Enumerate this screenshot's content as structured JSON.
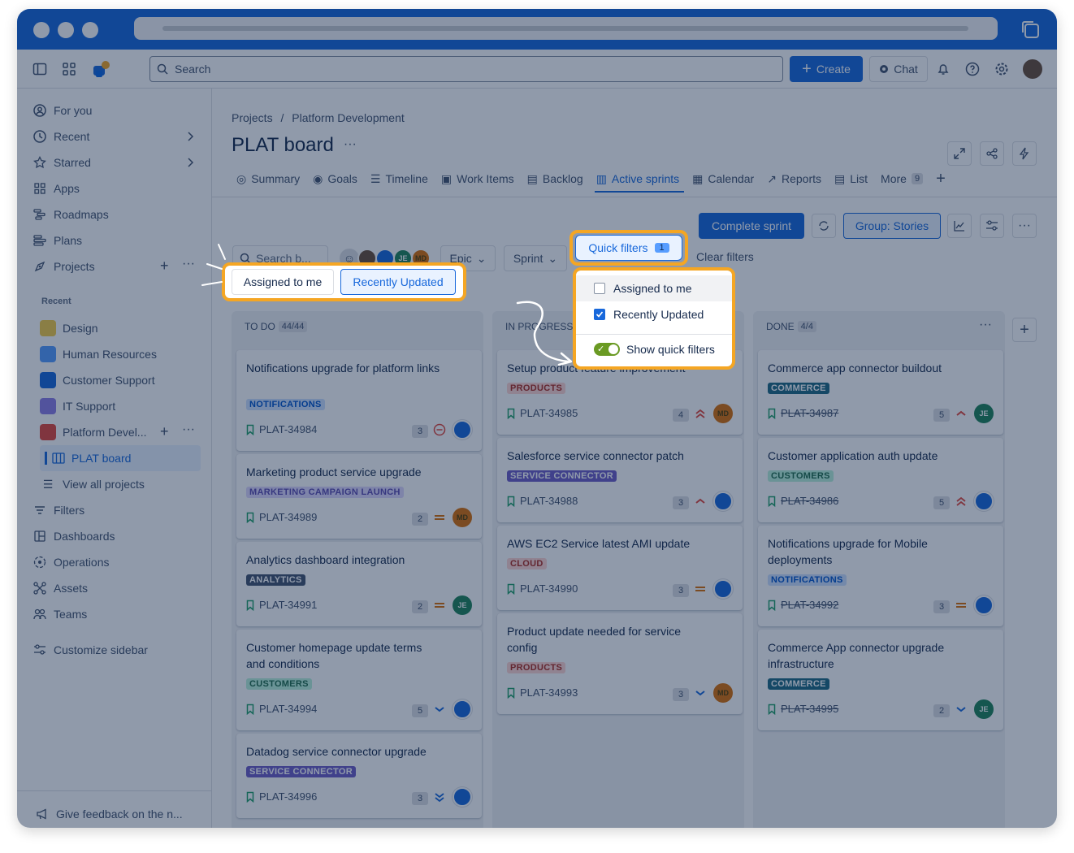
{
  "topnav": {
    "search_placeholder": "Search",
    "create_label": "Create",
    "chat_label": "Chat"
  },
  "sidebar": {
    "items": [
      {
        "label": "For you",
        "icon": "user-circle-icon"
      },
      {
        "label": "Recent",
        "icon": "clock-icon"
      },
      {
        "label": "Starred",
        "icon": "star-icon"
      },
      {
        "label": "Apps",
        "icon": "apps-icon"
      },
      {
        "label": "Roadmaps",
        "icon": "roadmap-icon"
      },
      {
        "label": "Plans",
        "icon": "plans-icon"
      },
      {
        "label": "Projects",
        "icon": "projects-icon"
      }
    ],
    "recent_header": "Recent",
    "projects": [
      {
        "label": "Design",
        "color": "#f5cd47"
      },
      {
        "label": "Human Resources",
        "color": "#579dff"
      },
      {
        "label": "Customer Support",
        "color": "#1868db"
      },
      {
        "label": "IT Support",
        "color": "#8f7ee7"
      },
      {
        "label": "Platform Devel...",
        "color": "#e2483d"
      }
    ],
    "board_label": "PLAT board",
    "view_all": "View all projects",
    "bottom_items": [
      {
        "label": "Filters",
        "icon": "filter-icon"
      },
      {
        "label": "Dashboards",
        "icon": "dashboard-icon"
      },
      {
        "label": "Operations",
        "icon": "operations-icon"
      },
      {
        "label": "Assets",
        "icon": "assets-icon"
      },
      {
        "label": "Teams",
        "icon": "teams-icon"
      }
    ],
    "customize": "Customize sidebar",
    "feedback": "Give feedback on the n..."
  },
  "breadcrumb": {
    "root": "Projects",
    "sep": "/",
    "project": "Platform Development"
  },
  "page_title": "PLAT board",
  "tabs": [
    {
      "label": "Summary"
    },
    {
      "label": "Goals"
    },
    {
      "label": "Timeline"
    },
    {
      "label": "Work Items"
    },
    {
      "label": "Backlog"
    },
    {
      "label": "Active sprints"
    },
    {
      "label": "Calendar"
    },
    {
      "label": "Reports"
    },
    {
      "label": "List"
    }
  ],
  "more_label": "More",
  "more_count": "9",
  "toolbar": {
    "complete_sprint": "Complete sprint",
    "group": "Group: Stories",
    "search_placeholder": "Search b...",
    "epic": "Epic",
    "sprint": "Sprint",
    "quick_filters": "Quick filters",
    "quick_filters_count": "1",
    "clear_filters": "Clear filters"
  },
  "avatars": {
    "je": "JE",
    "md": "MD"
  },
  "quick_chips": {
    "assigned": "Assigned to me",
    "recent": "Recently Updated"
  },
  "dropdown": {
    "assigned": "Assigned to me",
    "recent": "Recently Updated",
    "toggle": "Show quick filters"
  },
  "columns": [
    {
      "title": "TO DO",
      "count": "44/44",
      "cards": [
        {
          "title": "Notifications upgrade for platform links",
          "label": "NOTIFICATIONS",
          "key": "PLAT-34984",
          "est": "3"
        },
        {
          "title": "Marketing product service upgrade",
          "label": "MARKETING CAMPAIGN LAUNCH",
          "key": "PLAT-34989",
          "est": "2"
        },
        {
          "title": "Analytics dashboard integration",
          "label": "ANALYTICS",
          "key": "PLAT-34991",
          "est": "2"
        },
        {
          "title": "Customer homepage update terms and conditions",
          "label": "CUSTOMERS",
          "key": "PLAT-34994",
          "est": "5"
        },
        {
          "title": "Datadog service connector upgrade",
          "label": "SERVICE CONNECTOR",
          "key": "PLAT-34996",
          "est": "3"
        }
      ]
    },
    {
      "title": "IN PROGRESS",
      "count": "",
      "cards": [
        {
          "title": "Setup product feature improvement",
          "label": "PRODUCTS",
          "key": "PLAT-34985",
          "est": "4"
        },
        {
          "title": "Salesforce service connector patch",
          "label": "SERVICE CONNECTOR",
          "key": "PLAT-34988",
          "est": "3"
        },
        {
          "title": "AWS EC2 Service latest AMI update",
          "label": "CLOUD",
          "key": "PLAT-34990",
          "est": "3"
        },
        {
          "title": "Product update needed for service config",
          "label": "PRODUCTS",
          "key": "PLAT-34993",
          "est": "3"
        }
      ]
    },
    {
      "title": "DONE",
      "count": "4/4",
      "cards": [
        {
          "title": "Commerce app connector buildout",
          "label": "COMMERCE",
          "key": "PLAT-34987",
          "est": "5"
        },
        {
          "title": "Customer application auth update",
          "label": "CUSTOMERS",
          "key": "PLAT-34986",
          "est": "5"
        },
        {
          "title": "Notifications upgrade for Mobile deployments",
          "label": "NOTIFICATIONS",
          "key": "PLAT-34992",
          "est": "3"
        },
        {
          "title": "Commerce App connector upgrade infrastructure",
          "label": "COMMERCE",
          "key": "PLAT-34995",
          "est": "2"
        }
      ]
    }
  ]
}
